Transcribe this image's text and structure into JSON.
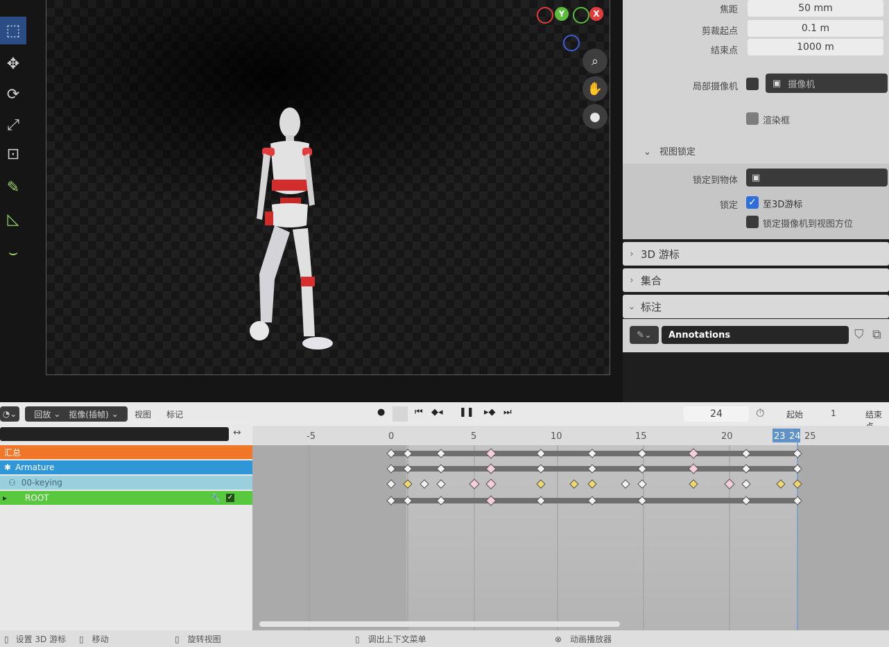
{
  "toolbar": {
    "tools": [
      "select-box",
      "move",
      "rotate",
      "scale",
      "transform",
      "annotate",
      "measure",
      "curve"
    ]
  },
  "gizmo": {
    "axes": [
      {
        "label": "",
        "color": "#e23c3c"
      },
      {
        "label": "Y",
        "color": "#5bbd3b"
      },
      {
        "label": "",
        "color": "#5bbd3b"
      },
      {
        "label": "X",
        "color": "#e23c3c"
      },
      {
        "label": "",
        "color": "#3a5fd6"
      }
    ]
  },
  "nav_buttons": [
    "zoom-icon",
    "hand-icon",
    "camera-icon"
  ],
  "properties": {
    "focal_label": "焦距",
    "focal_value": "50 mm",
    "clip_start_label": "剪裁起点",
    "clip_start_value": "0.1 m",
    "clip_end_label": "结束点",
    "clip_end_value": "1000 m",
    "local_camera_label": "局部摄像机",
    "local_camera_value": "摄像机",
    "render_region_label": "渲染框",
    "view_lock_title": "视图锁定",
    "lock_to_object_label": "锁定到物体",
    "lock_label": "锁定",
    "lock_3d_cursor_label": "至3D游标",
    "lock_camera_label": "锁定摄像机到视图方位"
  },
  "sections": [
    {
      "title": "3D 游标"
    },
    {
      "title": "集合"
    },
    {
      "title": "标注"
    }
  ],
  "annotations": {
    "name": "Annotations"
  },
  "timeline": {
    "playback_menu": "回放",
    "keying_menu": "抠像(插帧)",
    "view_menu": "视图",
    "marker_menu": "标记",
    "current_frame": "24",
    "start_label": "起始",
    "start_value": "1",
    "end_label": "结束点",
    "ruler": [
      "-5",
      "0",
      "5",
      "10",
      "15",
      "20",
      "23",
      "24",
      "25"
    ]
  },
  "channels": [
    {
      "name": "汇总",
      "color": "#f0772a"
    },
    {
      "name": "Armature",
      "color": "#2f96d8"
    },
    {
      "name": "00-keying",
      "color": "#9ad0de"
    },
    {
      "name": "ROOT",
      "color": "#58c83f"
    }
  ],
  "status_bar": {
    "item1": "设置 3D 游标",
    "item2": "移动",
    "item3": "旋转视图",
    "item4": "调出上下文菜单",
    "item5": "动画播放器"
  }
}
